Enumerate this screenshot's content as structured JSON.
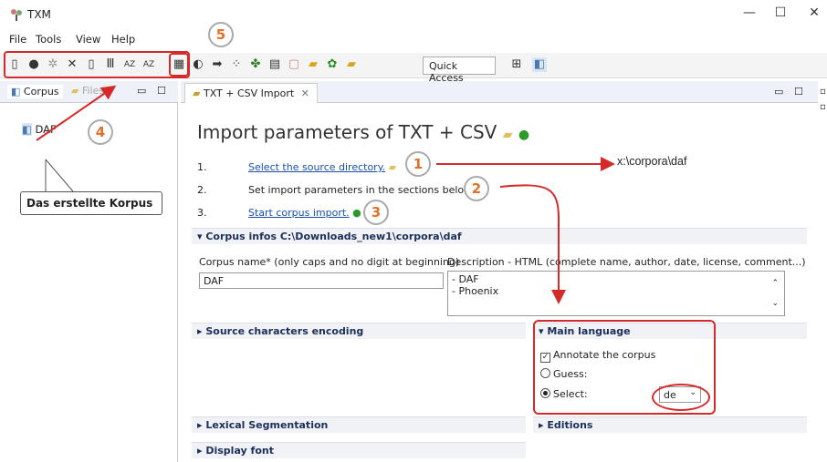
{
  "window": {
    "title": "TXM",
    "minimize": "—",
    "maximize": "☐",
    "close": "✕"
  },
  "menu": [
    "File",
    "Tools",
    "View",
    "Help"
  ],
  "toolbar": {
    "quick_access": "Quick Access"
  },
  "left_panel": {
    "tabs": [
      "Corpus",
      "Files"
    ],
    "tree_item": "DAF"
  },
  "callout": "Das erstellte Korpus",
  "annotations": [
    "1",
    "2",
    "3",
    "4",
    "5"
  ],
  "target_path": "x:\\corpora\\daf",
  "editor": {
    "tab_label": "TXT + CSV Import",
    "title": "Import parameters of TXT + CSV",
    "steps": [
      {
        "num": "1.",
        "text": "Select the source directory."
      },
      {
        "num": "2.",
        "text": "Set import parameters in the sections below."
      },
      {
        "num": "3.",
        "text": "Start corpus import."
      }
    ],
    "sections": {
      "corpus_infos": "Corpus  infos C:\\Downloads_new1\\corpora\\daf",
      "corpus_name_label": "Corpus name* (only caps and no digit at beginning)",
      "corpus_name_value": "DAF",
      "description_label": "Description - HTML (complete name, author, date, license, comment...)",
      "description_lines": [
        "- DAF",
        "- Phoenix"
      ],
      "source_encoding": "Source characters encoding",
      "main_language": "Main language",
      "annotate_label": "Annotate the corpus",
      "guess_label": "Guess:",
      "select_label": "Select:",
      "language_value": "de",
      "lexical_segmentation": "Lexical Segmentation",
      "editions": "Editions",
      "display_font": "Display font"
    }
  },
  "colors": {
    "accent_red": "#d42a2a",
    "annotation_orange": "#e0702a",
    "link_blue": "#1a4fb0"
  }
}
